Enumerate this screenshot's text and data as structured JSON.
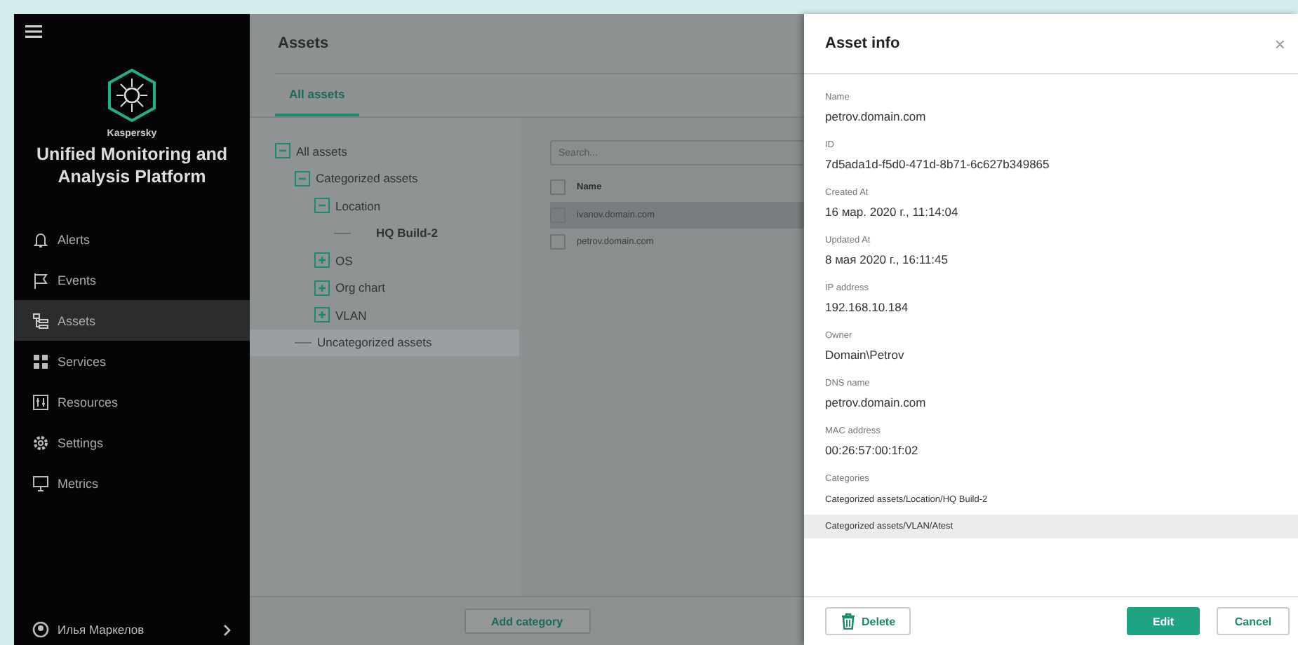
{
  "sidebar": {
    "brand": "Kaspersky",
    "product": "Unified Monitoring and Analysis Platform",
    "items": [
      {
        "label": "Alerts",
        "selected": false
      },
      {
        "label": "Events",
        "selected": false
      },
      {
        "label": "Assets",
        "selected": true
      },
      {
        "label": "Services",
        "selected": false
      },
      {
        "label": "Resources",
        "selected": false
      },
      {
        "label": "Settings",
        "selected": false
      },
      {
        "label": "Metrics",
        "selected": false
      }
    ],
    "user": "Илья Маркелов"
  },
  "main": {
    "title": "Assets",
    "tabs": [
      {
        "label": "All assets",
        "selected": true
      }
    ],
    "tree": [
      {
        "label": "All assets",
        "expanded": true,
        "selected": false,
        "highlighted": false,
        "children": [
          {
            "label": "Categorized assets",
            "expanded": true,
            "selected": false,
            "highlighted": false,
            "children": [
              {
                "label": "Location",
                "expanded": true,
                "selected": false,
                "highlighted": false,
                "children": [
                  {
                    "label": "HQ Build-2",
                    "selected": true,
                    "highlighted": false
                  }
                ]
              },
              {
                "label": "OS",
                "expanded": false,
                "selected": false,
                "highlighted": false
              },
              {
                "label": "Org chart",
                "expanded": false,
                "selected": false,
                "highlighted": false
              },
              {
                "label": "VLAN",
                "expanded": false,
                "selected": false,
                "highlighted": false
              }
            ]
          },
          {
            "label": "Uncategorized assets",
            "selected": false,
            "highlighted": true
          }
        ]
      }
    ],
    "search": {
      "placeholder": "Search..."
    },
    "table": {
      "columns": [
        "Name"
      ],
      "all_checked": false,
      "rows": [
        {
          "name": "ivanov.domain.com",
          "checked": false,
          "highlighted": true
        },
        {
          "name": "petrov.domain.com",
          "checked": false,
          "highlighted": false
        }
      ]
    },
    "add_button": "Add category"
  },
  "panel": {
    "title": "Asset info",
    "close": "×",
    "fields": [
      {
        "label": "Name",
        "value": "petrov.domain.com"
      },
      {
        "label": "ID",
        "value": "7d5ada1d-f5d0-471d-8b71-6c627b349865"
      },
      {
        "label": "Created At",
        "value": "16 мар. 2020 г., 11:14:04"
      },
      {
        "label": "Updated At",
        "value": "8 мая 2020 г., 16:11:45"
      },
      {
        "label": "IP address",
        "value": "192.168.10.184"
      },
      {
        "label": "Owner",
        "value": "Domain\\Petrov"
      },
      {
        "label": "DNS name",
        "value": "petrov.domain.com"
      },
      {
        "label": "MAC address",
        "value": "00:26:57:00:1f:02"
      }
    ],
    "categories_label": "Categories",
    "categories": [
      {
        "path": "Categorized assets/Location/HQ Build-2",
        "highlighted": false
      },
      {
        "path": "Categorized assets/VLAN/Atest",
        "highlighted": true
      }
    ],
    "buttons": {
      "delete": "Delete",
      "edit": "Edit",
      "cancel": "Cancel"
    }
  }
}
